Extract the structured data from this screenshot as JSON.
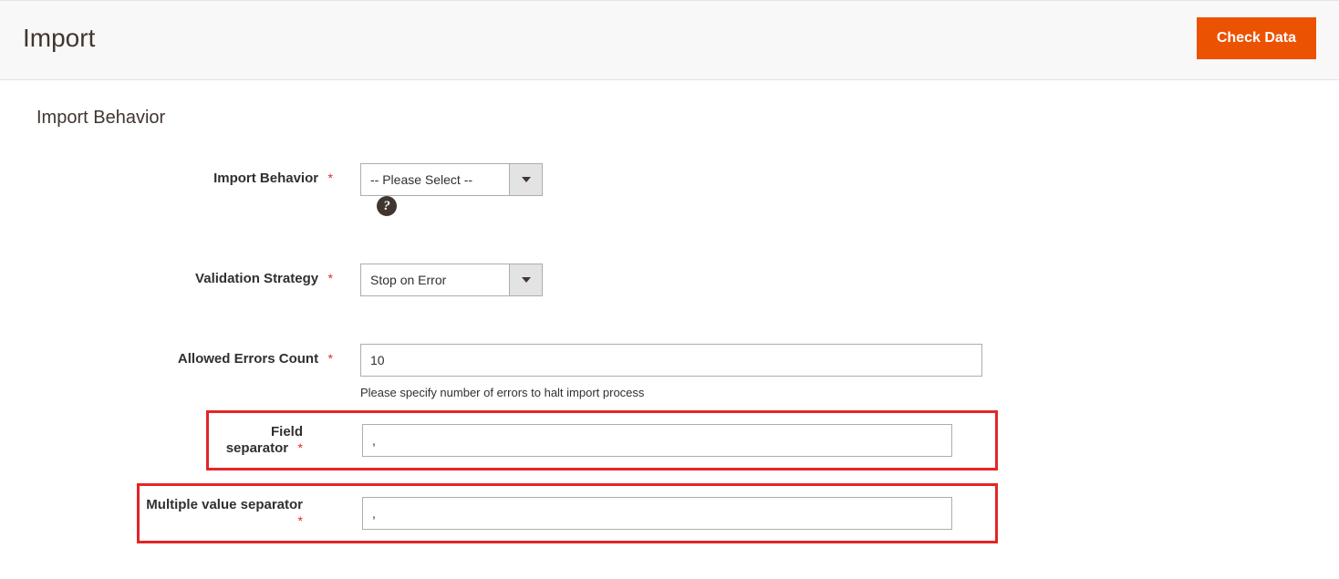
{
  "header": {
    "title": "Import",
    "check_data_label": "Check Data"
  },
  "fieldset": {
    "legend": "Import Behavior"
  },
  "fields": {
    "import_behavior": {
      "label": "Import Behavior",
      "required_mark": "*",
      "value": "-- Please Select --"
    },
    "validation_strategy": {
      "label": "Validation Strategy",
      "required_mark": "*",
      "value": "Stop on Error"
    },
    "allowed_errors": {
      "label": "Allowed Errors Count",
      "required_mark": "*",
      "value": "10",
      "note": "Please specify number of errors to halt import process"
    },
    "field_separator": {
      "label": "Field separator",
      "required_mark": "*",
      "value": ","
    },
    "multiple_value_separator": {
      "label": "Multiple value separator",
      "required_mark": "*",
      "value": ","
    }
  },
  "icons": {
    "help": "?"
  }
}
